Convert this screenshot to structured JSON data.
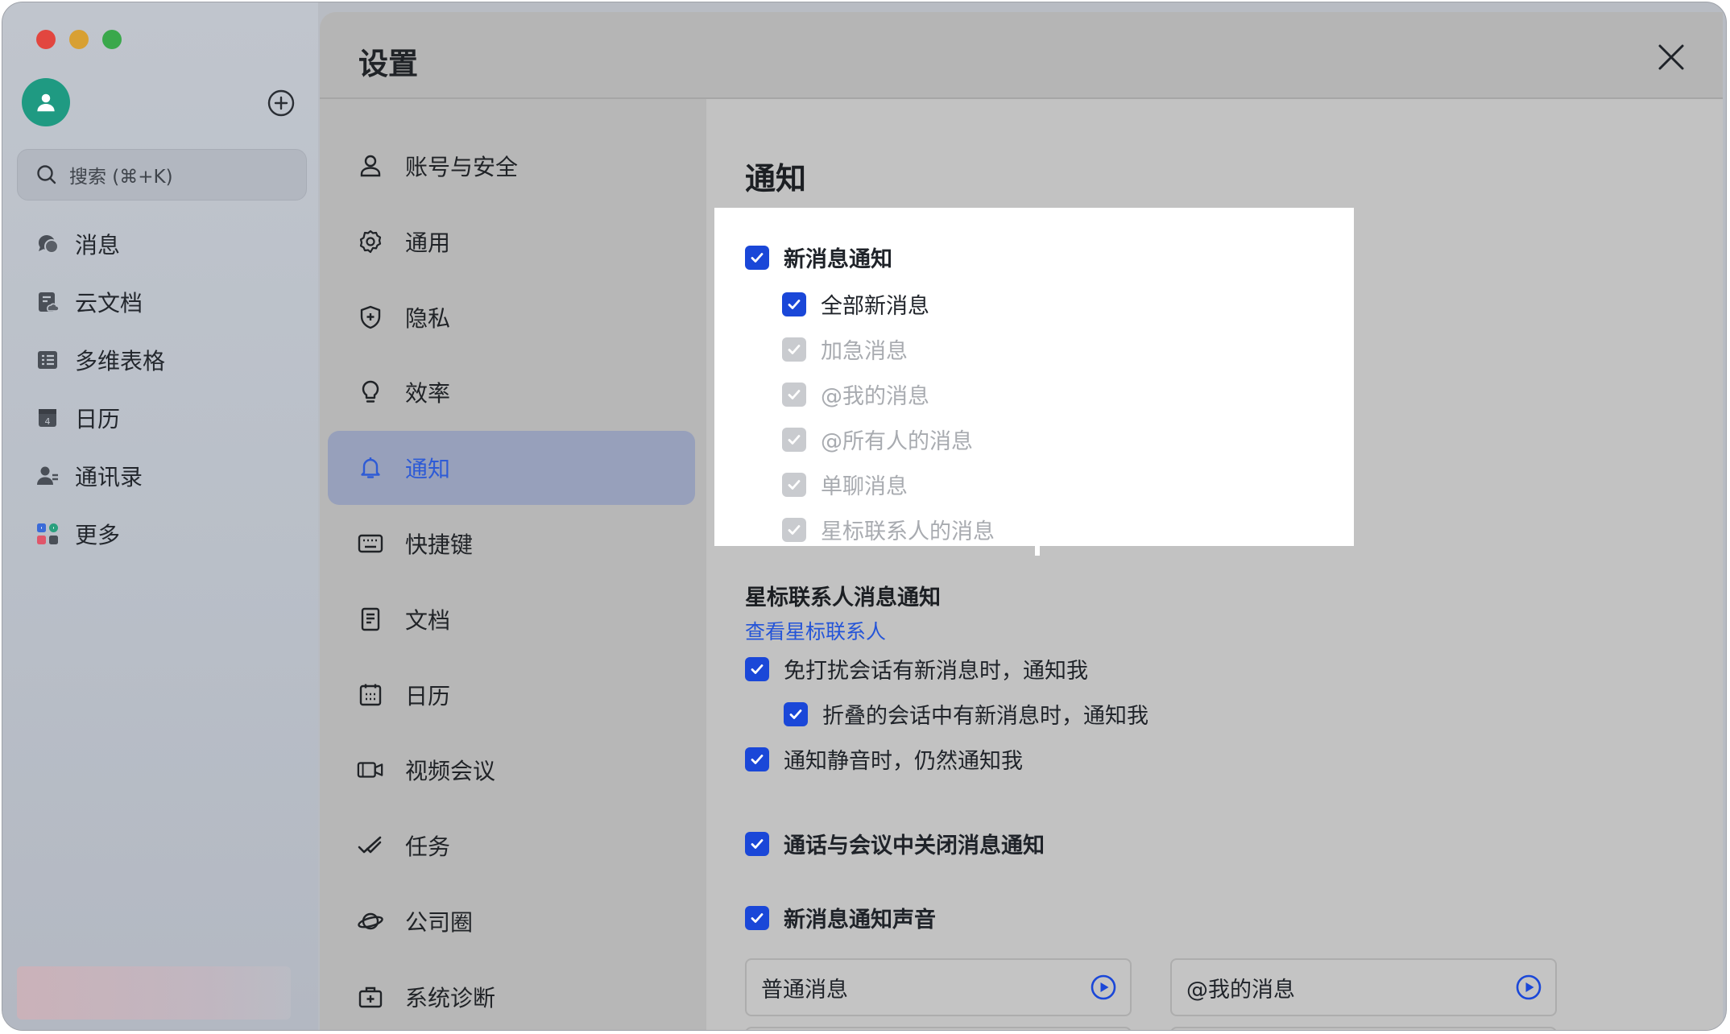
{
  "sidebar": {
    "search_placeholder": "搜索 (⌘+K)",
    "items": [
      {
        "label": "消息",
        "icon": "message-bubble-icon"
      },
      {
        "label": "云文档",
        "icon": "cloud-doc-icon"
      },
      {
        "label": "多维表格",
        "icon": "base-table-icon"
      },
      {
        "label": "日历",
        "icon": "calendar-icon"
      },
      {
        "label": "通讯录",
        "icon": "contacts-icon"
      },
      {
        "label": "更多",
        "icon": "more-apps-icon"
      }
    ]
  },
  "settings": {
    "title": "设置",
    "nav": [
      {
        "label": "账号与安全",
        "icon": "person-icon",
        "active": false
      },
      {
        "label": "通用",
        "icon": "gear-icon",
        "active": false
      },
      {
        "label": "隐私",
        "icon": "shield-icon",
        "active": false
      },
      {
        "label": "效率",
        "icon": "lightbulb-icon",
        "active": false
      },
      {
        "label": "通知",
        "icon": "bell-icon",
        "active": true
      },
      {
        "label": "快捷键",
        "icon": "keyboard-icon",
        "active": false
      },
      {
        "label": "文档",
        "icon": "document-icon",
        "active": false
      },
      {
        "label": "日历",
        "icon": "calendar-icon",
        "active": false
      },
      {
        "label": "视频会议",
        "icon": "video-icon",
        "active": false
      },
      {
        "label": "任务",
        "icon": "task-check-icon",
        "active": false
      },
      {
        "label": "公司圈",
        "icon": "planet-icon",
        "active": false
      },
      {
        "label": "系统诊断",
        "icon": "medkit-icon",
        "active": false
      }
    ]
  },
  "content": {
    "title": "通知",
    "new_message": {
      "label": "新消息通知",
      "checked": true,
      "options": [
        {
          "label": "全部新消息",
          "checked": true,
          "disabled": false
        },
        {
          "label": "加急消息",
          "checked": true,
          "disabled": true
        },
        {
          "label": "@我的消息",
          "checked": true,
          "disabled": true
        },
        {
          "label": "@所有人的消息",
          "checked": true,
          "disabled": true
        },
        {
          "label": "单聊消息",
          "checked": true,
          "disabled": true
        },
        {
          "label": "星标联系人的消息",
          "checked": true,
          "disabled": true
        }
      ]
    },
    "star_section": {
      "title": "星标联系人消息通知",
      "link": "查看星标联系人"
    },
    "dnd_notify": "免打扰会话有新消息时，通知我",
    "folded_notify": "折叠的会话中有新消息时，通知我",
    "muted_notify": "通知静音时，仍然通知我",
    "call_close": "通话与会议中关闭消息通知",
    "sound": {
      "label": "新消息通知声音",
      "normal": "普通消息",
      "mention": "@我的消息"
    }
  },
  "colors": {
    "accent": "#1a47d8",
    "link": "#2454d8",
    "avatar": "#1f9a82"
  }
}
